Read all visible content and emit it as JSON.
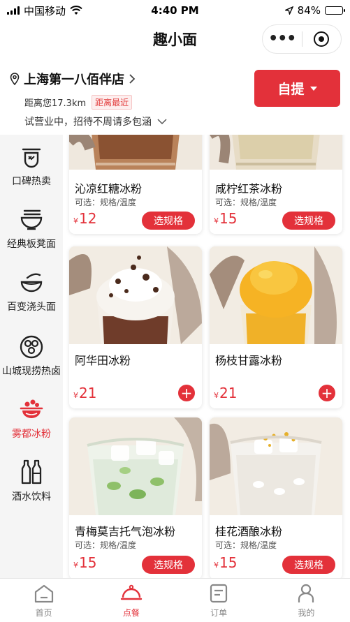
{
  "status_bar": {
    "carrier": "中国移动",
    "time": "4:40 PM",
    "battery": "84%",
    "battery_level": 0.84
  },
  "nav": {
    "title": "趣小面"
  },
  "store": {
    "name": "上海第一八佰伴店",
    "distance": "距离您17.3km",
    "tag": "距离最近",
    "note": "试营业中，招待不周请多包涵",
    "pickup_label": "自提"
  },
  "categories": [
    {
      "label": "口碑热卖",
      "icon": "bowl-pot-icon",
      "active": false
    },
    {
      "label": "经典板凳面",
      "icon": "noodle-bowl-icon",
      "active": false
    },
    {
      "label": "百变浇头面",
      "icon": "topping-bowl-icon",
      "active": false
    },
    {
      "label": "山城现捞热卤",
      "icon": "braise-pot-icon",
      "active": false
    },
    {
      "label": "雾都冰粉",
      "icon": "ice-jelly-icon",
      "active": true
    },
    {
      "label": "酒水饮料",
      "icon": "drink-bottles-icon",
      "active": false
    }
  ],
  "products": [
    {
      "name": "沁凉红糖冰粉",
      "options": "可选：规格/温度",
      "price": "12",
      "action": "选规格"
    },
    {
      "name": "咸柠红茶冰粉",
      "options": "可选：规格/温度",
      "price": "15",
      "action": "选规格"
    },
    {
      "name": "阿华田冰粉",
      "options": "",
      "price": "21",
      "action": "+"
    },
    {
      "name": "杨枝甘露冰粉",
      "options": "",
      "price": "21",
      "action": "+"
    },
    {
      "name": "青梅莫吉托气泡冰粉",
      "options": "可选：规格/温度",
      "price": "15",
      "action": "选规格"
    },
    {
      "name": "桂花酒酿冰粉",
      "options": "可选：规格/温度",
      "price": "15",
      "action": "选规格"
    }
  ],
  "currency": "¥",
  "tabs": [
    {
      "label": "首页",
      "icon": "home-icon",
      "active": false
    },
    {
      "label": "点餐",
      "icon": "cloche-icon",
      "active": true
    },
    {
      "label": "订单",
      "icon": "order-icon",
      "active": false
    },
    {
      "label": "我的",
      "icon": "profile-icon",
      "active": false
    }
  ],
  "colors": {
    "accent": "#e3313a",
    "sidebar_bg": "#f5f5f5"
  }
}
